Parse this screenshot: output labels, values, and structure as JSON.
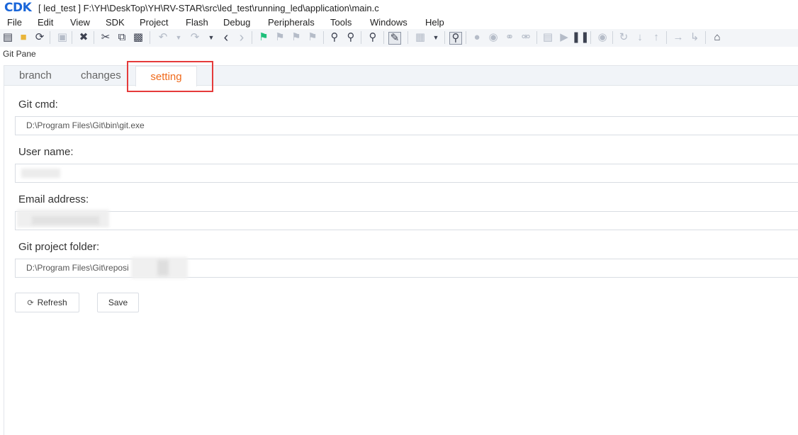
{
  "app": {
    "logo": "CDK",
    "title": "[ led_test ] F:\\YH\\DeskTop\\YH\\RV-STAR\\src\\led_test\\running_led\\application\\main.c"
  },
  "menu": [
    "File",
    "Edit",
    "View",
    "SDK",
    "Project",
    "Flash",
    "Debug",
    "Peripherals",
    "Tools",
    "Windows",
    "Help"
  ],
  "pane": {
    "label": "Git Pane"
  },
  "tabs": {
    "branch": "branch",
    "changes": "changes",
    "setting": "setting"
  },
  "settings": {
    "git_cmd_label": "Git cmd:",
    "git_cmd_value": "D:\\Program Files\\Git\\bin\\git.exe",
    "user_name_label": "User name:",
    "email_label": "Email address:",
    "folder_label": "Git project folder:",
    "folder_value": "D:\\Program Files\\Git\\reposi"
  },
  "buttons": {
    "refresh": "Refresh",
    "save": "Save"
  },
  "colors": {
    "logo": "#1a66d9",
    "active_tab": "#f06a1c",
    "highlight": "#e53b3b",
    "accent_green": "#1dbf7a"
  }
}
